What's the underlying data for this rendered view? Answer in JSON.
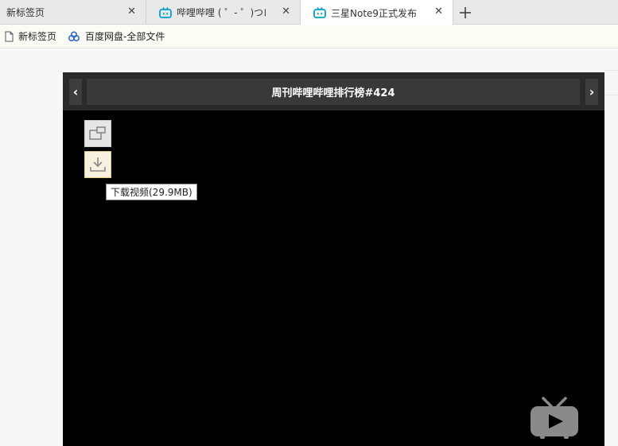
{
  "tabs": [
    {
      "title": "新标签页",
      "close": "✕",
      "active": false
    },
    {
      "title": "哔哩哔哩 ( ゜- ゜)つロ",
      "close": "✕",
      "active": false
    },
    {
      "title": "三星Note9正式发布",
      "close": "✕",
      "active": true
    }
  ],
  "new_tab": "+",
  "bookmarks": [
    {
      "label": "新标签页",
      "icon": "page-icon"
    },
    {
      "label": "百度网盘-全部文件",
      "icon": "baidu-netdisk-icon"
    }
  ],
  "player": {
    "title": "周刊哔哩哔哩排行榜#424",
    "prev": "‹",
    "next": "›",
    "download_tooltip": "下载视频(29.9MB)"
  },
  "colors": {
    "bilibili_blue": "#00a1d6",
    "player_bg": "#000000",
    "header_bg": "#2a2a2a"
  }
}
